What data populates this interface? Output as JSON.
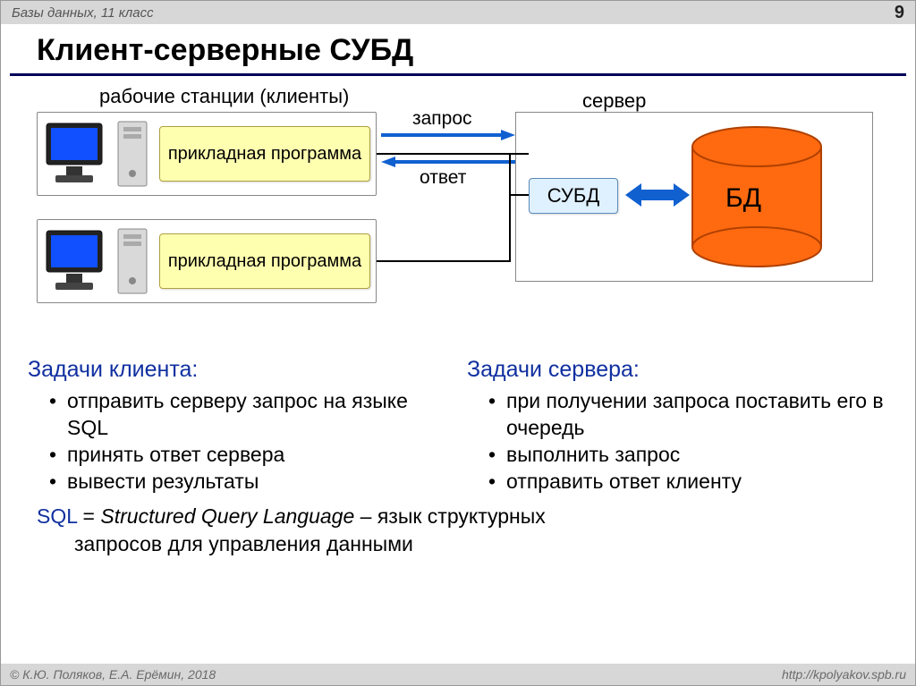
{
  "header": {
    "breadcrumb": "Базы данных, 11 класс",
    "page_number": "9"
  },
  "title": "Клиент-серверные СУБД",
  "diagram": {
    "workstations_label": "рабочие станции (клиенты)",
    "server_label": "сервер",
    "app_label": "прикладная программа",
    "request_label": "запрос",
    "response_label": "ответ",
    "subd_label": "СУБД",
    "db_label": "БД"
  },
  "tasks": {
    "client": {
      "heading": "Задачи клиента:",
      "items": [
        "отправить серверу запрос на языке SQL",
        "принять ответ сервера",
        "вывести результаты"
      ]
    },
    "server": {
      "heading": "Задачи сервера:",
      "items": [
        "при получении запроса поставить его в очередь",
        "выполнить запрос",
        "отправить ответ клиенту"
      ]
    }
  },
  "sql_note": {
    "prefix": "SQL",
    "equals": " = ",
    "english": "Structured Query Language",
    "dash_rest": " – язык структурных",
    "line2": "запросов для управления данными"
  },
  "footer": {
    "copyright": "© К.Ю. Поляков, Е.А. Ерёмин, 2018",
    "url": "http://kpolyakov.spb.ru"
  }
}
